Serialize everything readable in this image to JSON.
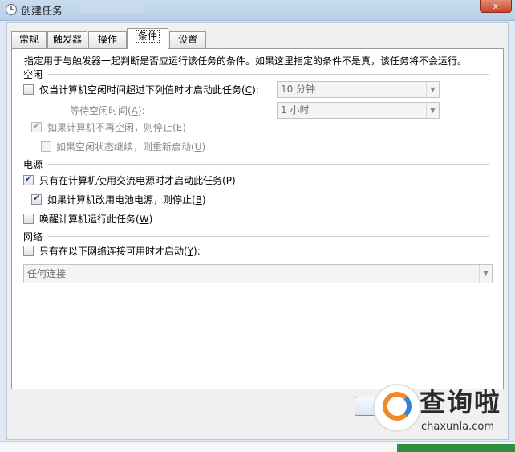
{
  "window": {
    "title": "创建任务",
    "close_label": "x"
  },
  "tabs": [
    {
      "label": "常规"
    },
    {
      "label": "触发器"
    },
    {
      "label": "操作"
    },
    {
      "label": "条件"
    },
    {
      "label": "设置"
    }
  ],
  "conditions": {
    "description": "指定用于与触发器一起判断是否应运行该任务的条件。如果这里指定的条件不是真，该任务将不会运行。",
    "idle": {
      "header": "空闲",
      "start_idle": {
        "label": "仅当计算机空闲时间超过下列值时才启动此任务(",
        "key": "C",
        "suffix": "):",
        "checked": false,
        "combo_value": "10 分钟"
      },
      "wait_idle": {
        "label": "等待空闲时间(",
        "key": "A",
        "suffix": "):",
        "combo_value": "1 小时"
      },
      "stop_if_not_idle": {
        "label": "如果计算机不再空闲，则停止(",
        "key": "E",
        "suffix": ")",
        "checked": true
      },
      "restart_if_idle": {
        "label": "如果空闲状态继续，则重新启动(",
        "key": "U",
        "suffix": ")",
        "checked": false
      }
    },
    "power": {
      "header": "电源",
      "ac_only": {
        "label": "只有在计算机使用交流电源时才启动此任务(",
        "key": "P",
        "suffix": ")",
        "checked": true
      },
      "stop_on_battery": {
        "label": "如果计算机改用电池电源，则停止(",
        "key": "B",
        "suffix": ")",
        "checked": true
      },
      "wake": {
        "label": "唤醒计算机运行此任务(",
        "key": "W",
        "suffix": ")",
        "checked": false
      }
    },
    "network": {
      "header": "网络",
      "only_if_network": {
        "label": "只有在以下网络连接可用时才启动(",
        "key": "Y",
        "suffix": "):",
        "checked": false
      },
      "connection_value": "任何连接"
    }
  },
  "watermark": {
    "name": "查询啦",
    "url": "chaxunla.com"
  }
}
